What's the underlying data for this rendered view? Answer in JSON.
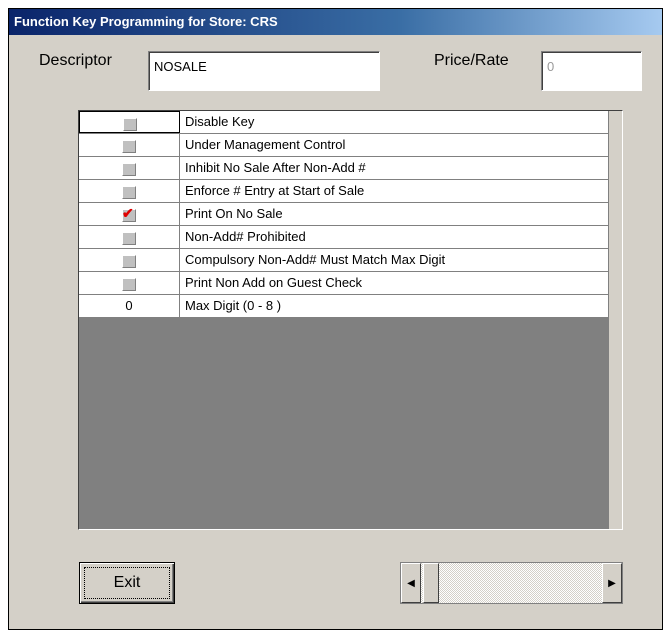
{
  "window": {
    "title": "Function Key Programming for Store: CRS"
  },
  "form": {
    "descriptor_label": "Descriptor",
    "descriptor_value": "NOSALE",
    "price_label": "Price/Rate",
    "price_value": "0"
  },
  "options": [
    {
      "kind": "checkbox",
      "checked": false,
      "label": "Disable Key"
    },
    {
      "kind": "checkbox",
      "checked": false,
      "label": "Under Management Control"
    },
    {
      "kind": "checkbox",
      "checked": false,
      "label": "Inhibit No Sale After Non-Add #"
    },
    {
      "kind": "checkbox",
      "checked": false,
      "label": "Enforce # Entry at Start of Sale"
    },
    {
      "kind": "checkbox",
      "checked": true,
      "label": "Print On No Sale"
    },
    {
      "kind": "checkbox",
      "checked": false,
      "label": "Non-Add# Prohibited"
    },
    {
      "kind": "checkbox",
      "checked": false,
      "label": "Compulsory Non-Add# Must Match Max Digit"
    },
    {
      "kind": "checkbox",
      "checked": false,
      "label": "Print Non Add on Guest Check"
    },
    {
      "kind": "number",
      "value": "0",
      "label": "Max Digit (0 - 8 )"
    }
  ],
  "buttons": {
    "exit_label": "Exit"
  },
  "icons": {
    "scroll_left": "arrow-left-icon",
    "scroll_right": "arrow-right-icon",
    "checkmark": "checkmark-icon"
  },
  "colors": {
    "title_bar": "#0a246a",
    "check_mark": "#e00000",
    "window_bg": "#d4d0c8"
  }
}
